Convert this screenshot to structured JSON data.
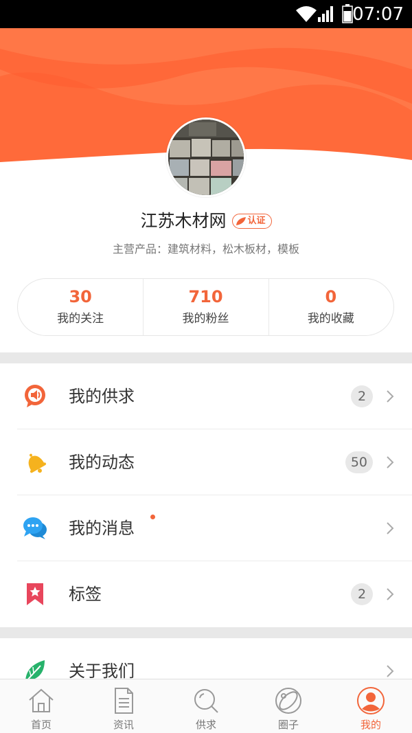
{
  "status_bar": {
    "time": "07:07"
  },
  "profile": {
    "name": "江苏木材网",
    "verified_badge": "认证",
    "products": "主营产品：建筑材料，松木板材，模板"
  },
  "stats": [
    {
      "value": "30",
      "label": "我的关注"
    },
    {
      "value": "710",
      "label": "我的粉丝"
    },
    {
      "value": "0",
      "label": "我的收藏"
    }
  ],
  "menu": [
    {
      "label": "我的供求",
      "badge": "2",
      "icon": "speech-bubble-speaker-icon"
    },
    {
      "label": "我的动态",
      "badge": "50",
      "icon": "bell-icon"
    },
    {
      "label": "我的消息",
      "badge": "",
      "has_dot": true,
      "icon": "chat-bubbles-icon"
    },
    {
      "label": "标签",
      "badge": "2",
      "icon": "bookmark-star-icon"
    },
    {
      "label": "关于我们",
      "badge": "",
      "icon": "leaf-icon"
    }
  ],
  "tabs": [
    {
      "label": "首页",
      "icon": "home-icon",
      "active": false
    },
    {
      "label": "资讯",
      "icon": "document-icon",
      "active": false
    },
    {
      "label": "供求",
      "icon": "search-icon",
      "active": false
    },
    {
      "label": "圈子",
      "icon": "planet-icon",
      "active": false
    },
    {
      "label": "我的",
      "icon": "user-icon",
      "active": true
    }
  ],
  "colors": {
    "accent": "#f2653a",
    "header_light": "#ff8a5c",
    "header_dark": "#ff5a2a"
  }
}
